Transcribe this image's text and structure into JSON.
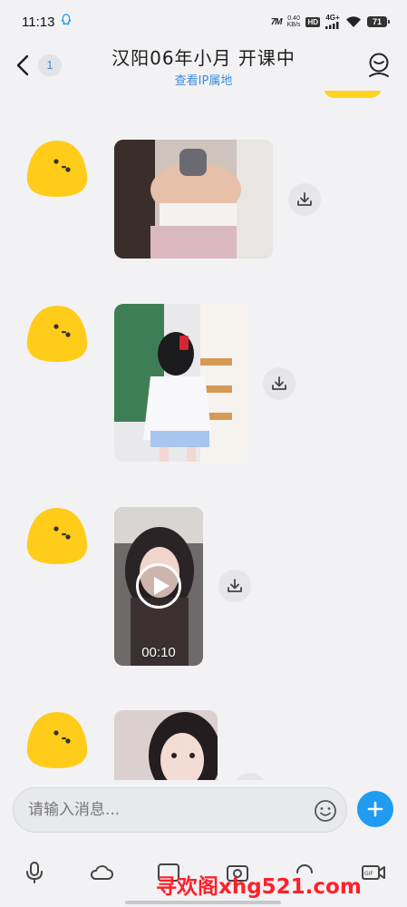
{
  "status_bar": {
    "time": "11:13",
    "net_speed": "0.40",
    "net_unit": "KB/s",
    "hd_badge": "HD",
    "signal_label": "4G+",
    "battery": "71"
  },
  "header": {
    "unread_count": "1",
    "title": "汉阳06年小月 开课中",
    "subtitle": "查看IP属地"
  },
  "messages": [
    {
      "type": "image",
      "content": "photo"
    },
    {
      "type": "image",
      "content": "photo"
    },
    {
      "type": "video",
      "duration": "00:10"
    },
    {
      "type": "image",
      "content": "photo"
    }
  ],
  "input": {
    "placeholder": "请输入消息..."
  },
  "toolbar": {
    "items": [
      "microphone-icon",
      "cloud-icon",
      "image-icon",
      "camera-icon",
      "voice-call-icon",
      "gif-icon",
      "video-call-icon"
    ]
  },
  "watermark": "寻欢阁xhg521.com",
  "colors": {
    "accent": "#1f9bf2",
    "avatar_yellow": "#ffcc1a",
    "link_blue": "#3a8be0",
    "watermark_red": "#ff1f2a"
  }
}
